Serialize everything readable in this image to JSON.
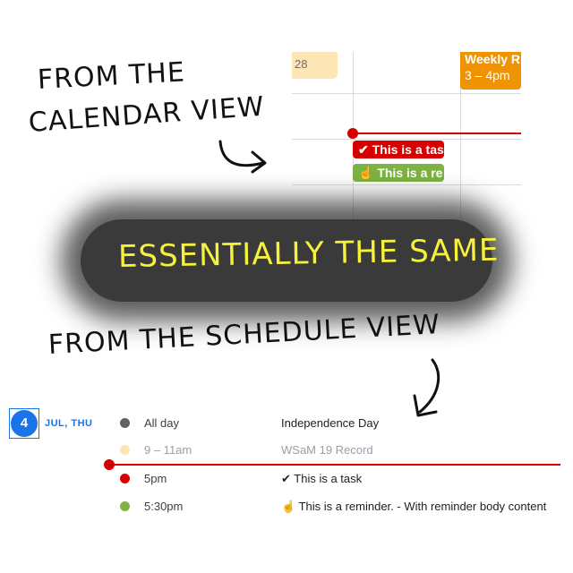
{
  "annotations": {
    "from_calendar_line1": "FROM THE",
    "from_calendar_line2": "CALENDAR VIEW",
    "banner": "ESSENTIALLY THE SAME",
    "from_schedule": "FROM THE SCHEDULE VIEW"
  },
  "calendar": {
    "date_number": "28",
    "weekly_event_title": "Weekly R",
    "weekly_event_time": "3 – 4pm",
    "task_chip": "✔ This is a tas",
    "reminder_chip": "This is a re",
    "colors": {
      "task": "#d50000",
      "reminder": "#7cb342",
      "weekly": "#f09300",
      "faint": "#fde5b6"
    }
  },
  "schedule": {
    "date": {
      "number": "4",
      "label": "JUL, THU"
    },
    "events": [
      {
        "time": "All day",
        "title": "Independence Day",
        "dot_color": "#616161",
        "faded": false
      },
      {
        "time": "9 – 11am",
        "title": "WSaM 19 Record",
        "dot_color": "#fde5b6",
        "faded": true
      },
      {
        "time": "5pm",
        "title": "✔ This is a task",
        "dot_color": "#d50000",
        "faded": false
      },
      {
        "time": "5:30pm",
        "title": "This is a reminder. - With reminder body content",
        "dot_color": "#7cb342",
        "faded": false
      }
    ]
  }
}
